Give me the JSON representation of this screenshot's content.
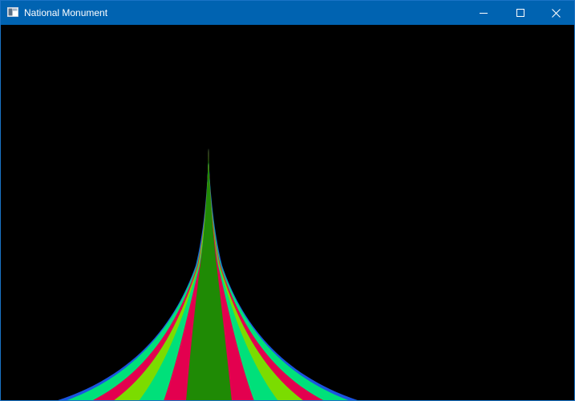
{
  "window": {
    "title": "National Monument",
    "icons": {
      "app": "window-app-icon",
      "minimize": "minimize-icon",
      "maximize": "maximize-icon",
      "close": "close-icon"
    },
    "titlebar_color": "#0063b1"
  },
  "canvas": {
    "background": "#000000",
    "scene": "monument-spire",
    "band_colors": {
      "green": "#1f8a05",
      "crimson": "#e3004f",
      "mint": "#00e07a",
      "lime": "#7bdc00",
      "blue": "#1a55e0"
    }
  }
}
